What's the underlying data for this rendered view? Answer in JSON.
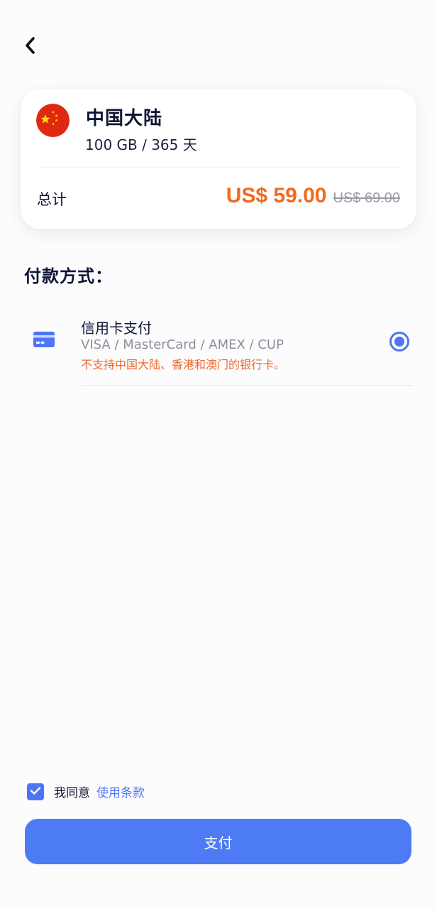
{
  "header": {
    "back_icon": "chevron-left-icon"
  },
  "product": {
    "flag_icon": "china-flag-icon",
    "region": "中国大陆",
    "plan": "100 GB / 365 天",
    "total_label": "总计",
    "price": "US$ 59.00",
    "original_price": "US$ 69.00"
  },
  "payment": {
    "section_title": "付款方式：",
    "methods": [
      {
        "icon": "credit-card-icon",
        "name": "信用卡支付",
        "brands": "VISA / MasterCard / AMEX / CUP",
        "note": "不支持中国大陆、香港和澳门的银行卡。",
        "selected": true
      }
    ]
  },
  "agreement": {
    "checked": true,
    "text": "我同意",
    "link_text": "使用条款"
  },
  "pay_button": {
    "label": "支付"
  },
  "colors": {
    "accent": "#4c76f5",
    "price": "#f26a1b",
    "warning": "#f0662a",
    "text": "#0f1534"
  }
}
